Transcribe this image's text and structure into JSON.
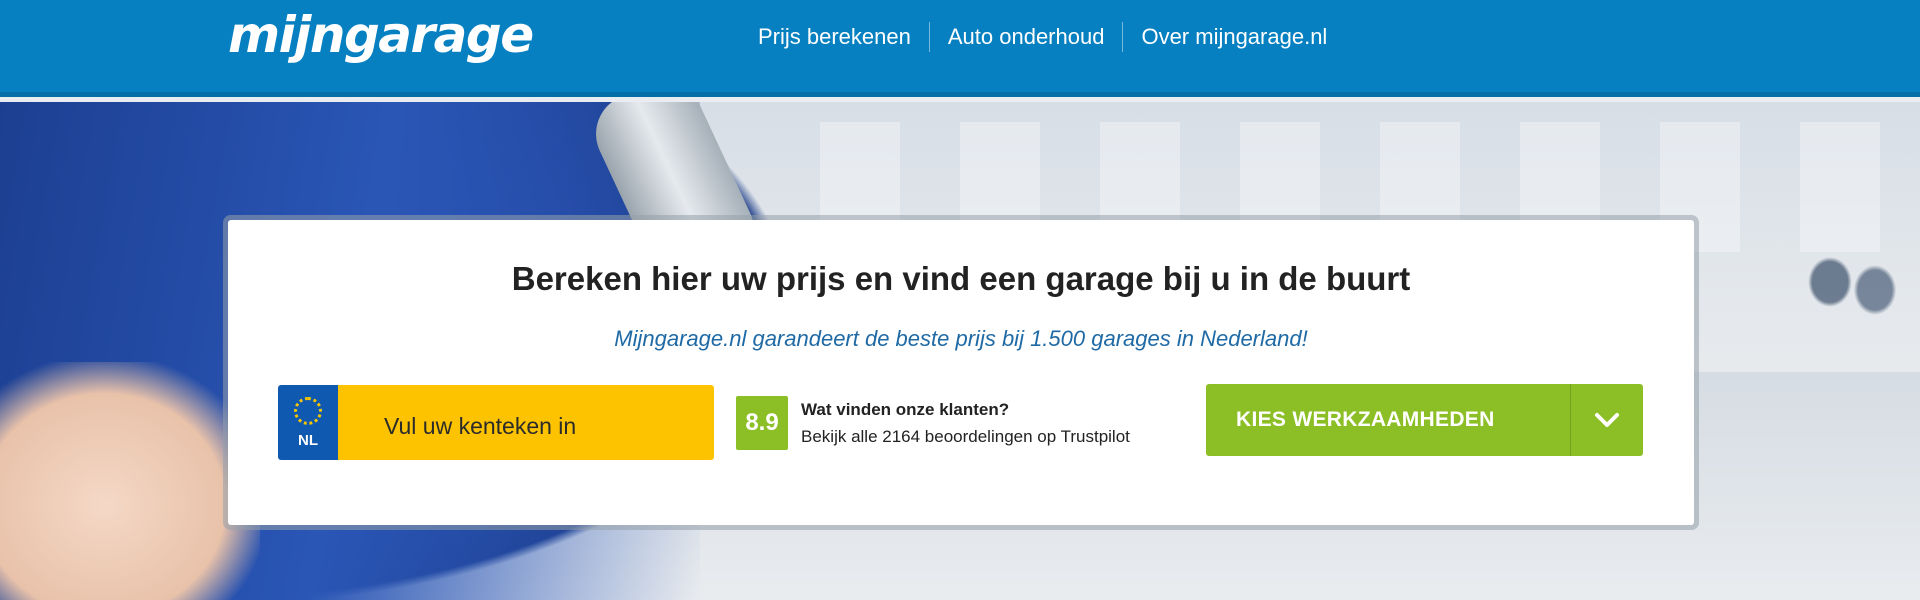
{
  "header": {
    "logo": "mijngarage",
    "nav": [
      {
        "label": "Prijs berekenen"
      },
      {
        "label": "Auto onderhoud"
      },
      {
        "label": "Over mijngarage.nl"
      }
    ],
    "color": "#0680c0"
  },
  "card": {
    "title": "Bereken hier uw prijs en vind een garage bij u in de buurt",
    "subtitle": "Mijngarage.nl garandeert de beste prijs bij 1.500 garages in Nederland!",
    "plate": {
      "country": "NL",
      "placeholder": "Vul uw kenteken in",
      "icon": "eu-stars-icon"
    },
    "rating": {
      "score": "8.9",
      "question": "Wat vinden onze klanten?",
      "link_text": "Bekijk alle 2164 beoordelingen op Trustpilot"
    },
    "cta": {
      "label": "KIES WERKZAAMHEDEN",
      "icon": "chevron-down-icon"
    }
  },
  "colors": {
    "accent_green": "#8cbf26",
    "plate_yellow": "#fdc300",
    "eu_blue": "#0f5ab0",
    "subtitle_blue": "#1f6aa5"
  }
}
